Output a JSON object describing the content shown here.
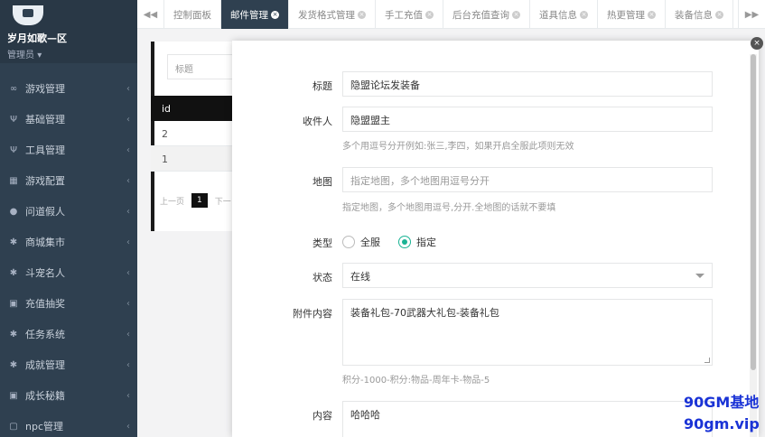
{
  "sidebar": {
    "user_name": "岁月如歌—区",
    "user_role": "管理员",
    "items": [
      {
        "label": "游戏管理",
        "icon": "gamepad-icon",
        "glyph": "∞"
      },
      {
        "label": "基础管理",
        "icon": "cutlery-icon",
        "glyph": "Ψ"
      },
      {
        "label": "工具管理",
        "icon": "cutlery-icon",
        "glyph": "Ψ"
      },
      {
        "label": "游戏配置",
        "icon": "table-icon",
        "glyph": "▦"
      },
      {
        "label": "问道假人",
        "icon": "user-icon",
        "glyph": "●"
      },
      {
        "label": "商城集市",
        "icon": "cog-icon",
        "glyph": "✱"
      },
      {
        "label": "斗宠名人",
        "icon": "cog-icon",
        "glyph": "✱"
      },
      {
        "label": "充值抽奖",
        "icon": "money-icon",
        "glyph": "▣"
      },
      {
        "label": "任务系统",
        "icon": "cog-icon",
        "glyph": "✱"
      },
      {
        "label": "成就管理",
        "icon": "cog-icon",
        "glyph": "✱"
      },
      {
        "label": "成长秘籍",
        "icon": "money-icon",
        "glyph": "▣"
      },
      {
        "label": "npc管理",
        "icon": "square-icon",
        "glyph": "▢"
      }
    ]
  },
  "tabs": [
    {
      "label": "控制面板",
      "closable": false,
      "active": false
    },
    {
      "label": "邮件管理",
      "closable": true,
      "active": true
    },
    {
      "label": "发货格式管理",
      "closable": true,
      "active": false
    },
    {
      "label": "手工充值",
      "closable": true,
      "active": false
    },
    {
      "label": "后台充值查询",
      "closable": true,
      "active": false
    },
    {
      "label": "道具信息",
      "closable": true,
      "active": false
    },
    {
      "label": "热更管理",
      "closable": true,
      "active": false
    },
    {
      "label": "装备信息",
      "closable": true,
      "active": false
    }
  ],
  "background": {
    "search_placeholder": "标题",
    "table_header": "id",
    "rows": [
      "2",
      "1"
    ],
    "pager_prev": "上一页",
    "pager_page": "1",
    "pager_next": "下一"
  },
  "form": {
    "title_label": "标题",
    "title_value": "隐盟论坛发装备",
    "recipient_label": "收件人",
    "recipient_value": "隐盟盟主",
    "recipient_help": "多个用逗号分开例如:张三,李四，如果开启全服此项则无效",
    "map_label": "地图",
    "map_placeholder": "指定地图，多个地图用逗号分开",
    "map_help": "指定地图，多个地图用逗号,分开.全地图的话就不要填",
    "type_label": "类型",
    "type_options": [
      "全服",
      "指定"
    ],
    "type_selected": "指定",
    "status_label": "状态",
    "status_value": "在线",
    "attachment_label": "附件内容",
    "attachment_value": "装备礼包-70武器大礼包-装备礼包",
    "attachment_help": "积分-1000-积分:物品-周年卡-物品-5",
    "content_label": "内容",
    "content_value": "哈哈哈"
  },
  "watermark": {
    "line1": "90GM基地",
    "line2": "90gm.vip",
    "color": "#1a33d6"
  },
  "colors": {
    "sidebar_bg": "#2f4050",
    "accent_green": "#1ab394"
  }
}
